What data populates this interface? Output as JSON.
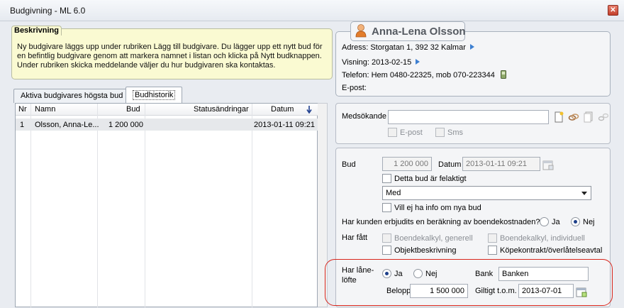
{
  "window": {
    "title": "Budgivning - ML 6.0",
    "close_label": "✕"
  },
  "info": {
    "title": "Beskrivning",
    "lines": [
      "Ny budgivare läggs upp under rubriken Lägg till budgivare. Du lägger upp ett nytt bud för",
      "en befintlig budgivare genom att markera namnet i listan och klicka på Nytt budknappen.",
      "Under rubriken skicka meddelande väljer du hur budgivaren ska kontaktas."
    ]
  },
  "contact": {
    "name": "Anna-Lena Olsson",
    "address": "Adress: Storgatan 1, 392 32  Kalmar",
    "viewing": "Visning: 2013-02-15",
    "phone": "Telefon: Hem 0480-22325, mob 070-223344",
    "email": "E-post:"
  },
  "tabs": [
    {
      "label": "Aktiva budgivares högsta bud",
      "active": false
    },
    {
      "label": "Budhistorik",
      "active": true
    }
  ],
  "table": {
    "columns": [
      "Nr",
      "Namn",
      "Bud",
      "Statusändringar",
      "Datum"
    ],
    "sort_icon": "sort-down-arrow-icon",
    "rows": [
      {
        "nr": "1",
        "namn": "Olsson, Anna-Le...",
        "bud": "1 200 000",
        "status": "",
        "datum": "2013-01-11 09:21"
      }
    ]
  },
  "medsokande": {
    "label": "Medsökande",
    "value": "",
    "email_label": "E-post",
    "sms_label": "Sms"
  },
  "bid": {
    "label": "Bud",
    "amount": "1 200 000",
    "date_label": "Datum",
    "date": "2013-01-11 09:21",
    "invalid_label": "Detta bud är felaktigt",
    "status_option": "Med",
    "no_info_label": "Vill ej ha info om nya bud",
    "cost_question": "Har kunden erbjudits en beräkning av boendekostnaden?",
    "yes": "Ja",
    "no": "Nej",
    "received_label": "Har fått",
    "checks": [
      "Boendekalkyl, generell",
      "Boendekalkyl, individuell",
      "Objektbeskrivning",
      "Köpekontrakt/överlåtelseavtal"
    ]
  },
  "loan": {
    "label_line1": "Har låne-",
    "label_line2": "löfte",
    "yes": "Ja",
    "no": "Nej",
    "bank_label": "Bank",
    "bank": "Banken",
    "amount_label": "Belopp",
    "amount": "1 500 000",
    "valid_label": "Giltigt t.o.m.",
    "valid_date": "2013-07-01"
  },
  "colors": {
    "highlight": "#d9261c",
    "info_bg": "#fafad2",
    "accent": "#3d7fd1"
  }
}
